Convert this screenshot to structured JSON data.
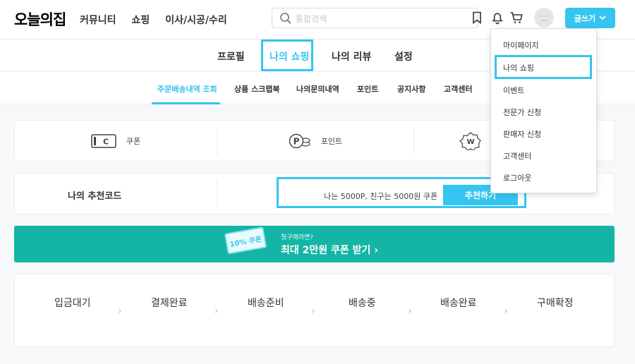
{
  "header": {
    "logo": "오늘의집",
    "nav": [
      "커뮤니티",
      "쇼핑",
      "이사/시공/수리"
    ],
    "search_placeholder": "통합검색",
    "write_button": "글쓰기"
  },
  "tabs": [
    "프로필",
    "나의 쇼핑",
    "나의 리뷰",
    "설정"
  ],
  "active_tab": "나의 쇼핑",
  "subtabs": [
    "주문배송내역 조회",
    "상품 스크랩북",
    "나의문의내역",
    "포인트",
    "공지사항",
    "고객센터"
  ],
  "point_cards": [
    {
      "icon": "coupon-icon",
      "icon_text": "C",
      "label": "쿠폰"
    },
    {
      "icon": "point-icon",
      "icon_text": "P",
      "label": "포인트"
    },
    {
      "icon": "grade-icon",
      "icon_text": "W",
      "label": ""
    }
  ],
  "referral": {
    "label": "나의 추천코드",
    "text": "나는 5000P, 친구는 5000원 쿠폰",
    "button": "추천하기"
  },
  "banner": {
    "ticket": "10% 쿠폰",
    "subtitle": "첫구매라면?",
    "title": "최대 2만원 쿠폰 받기"
  },
  "order_steps": [
    "입금대기",
    "결제완료",
    "배송준비",
    "배송중",
    "배송완료",
    "구매확정"
  ],
  "dropdown": [
    "마이페이지",
    "나의 쇼핑",
    "이벤트",
    "전문가 신청",
    "판매자 신청",
    "고객센터",
    "로그아웃"
  ],
  "colors": {
    "accent": "#35c5f0",
    "banner": "#14b5a5"
  }
}
